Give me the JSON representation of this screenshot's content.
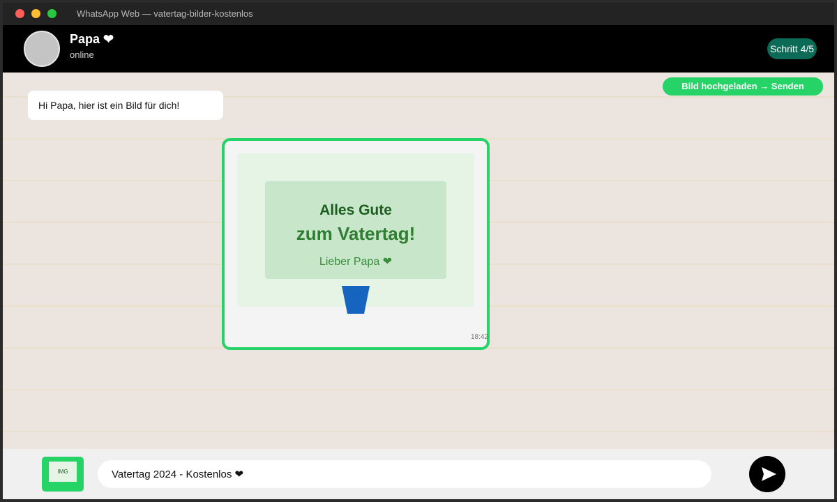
{
  "window": {
    "title": "WhatsApp Web — vatertag-bilder-kostenlos"
  },
  "header": {
    "contact_name": "Papa ❤",
    "status": "online",
    "step_badge": "Schritt 4/5"
  },
  "toast": {
    "label": "Bild hochgeladen → Senden"
  },
  "messages": {
    "incoming_text": "Hi Papa, hier ist ein Bild für dich!",
    "image_card": {
      "line1": "Alles Gute",
      "line2": "zum Vatertag!",
      "line3": "Lieber Papa ❤",
      "time": "18:42"
    }
  },
  "composer": {
    "attach_label": "IMG",
    "input_value": "Vatertag 2024 - Kostenlos ❤"
  },
  "colors": {
    "accent": "#25d366",
    "header_bg": "#000000",
    "badge_bg": "#0b6b57",
    "chat_bg": "#ece5df",
    "cup": "#1565c0"
  },
  "icons": {
    "send": "send-icon",
    "cup": "cup-icon",
    "avatar": "avatar"
  }
}
